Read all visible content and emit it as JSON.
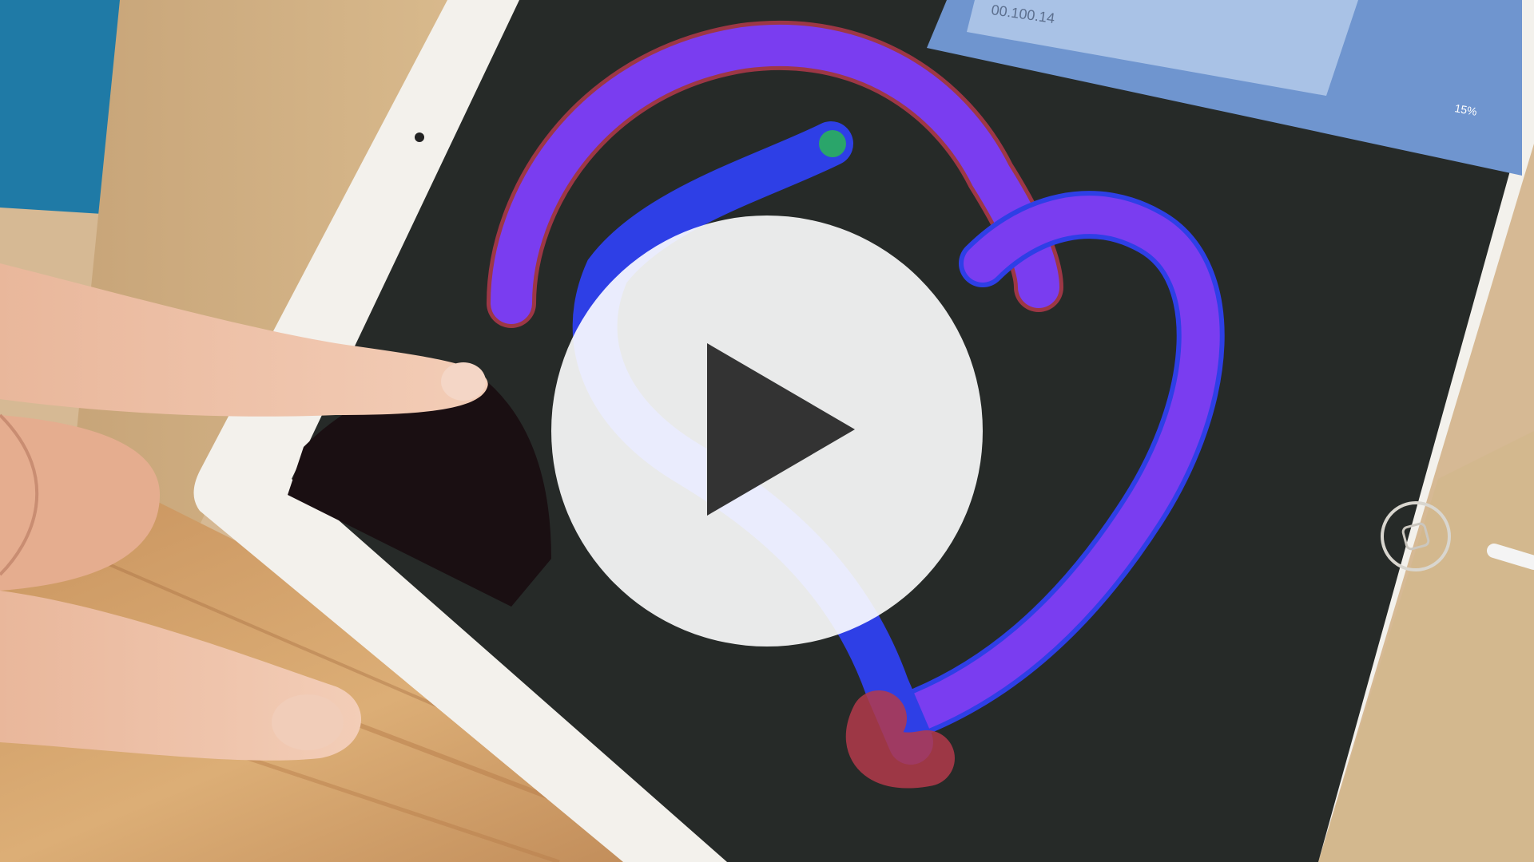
{
  "video": {
    "state": "paused",
    "play_button_icon": "play-icon"
  },
  "frame": {
    "address_bar_text": "00.100.14",
    "battery_text": "15%"
  },
  "colors": {
    "play_button_fill": "#FFFFFF",
    "play_triangle": "#333333",
    "tablet_screen": "#262a28",
    "stroke_primary": "#7a3df0",
    "stroke_secondary": "#2e3fe6",
    "stroke_shadow": "#b33a4a",
    "safari_bar": "#6f95cf"
  }
}
